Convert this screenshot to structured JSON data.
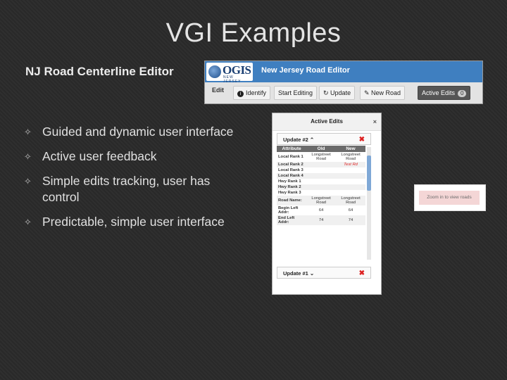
{
  "slide": {
    "title": "VGI Examples",
    "subtitle": "NJ Road Centerline Editor",
    "bullets": [
      "Guided and dynamic user interface",
      "Active user feedback",
      "Simple edits tracking, user has control",
      "Predictable, simple user interface"
    ]
  },
  "editor": {
    "logo_text": "OGIS",
    "logo_sub": "NEW JERSEY",
    "app_title": "New Jersey Road Editor",
    "toolbar": {
      "edit_label": "Edit",
      "identify_label": "Identify",
      "start_label": "Start Editing",
      "update_label": "Update",
      "new_road_label": "New Road",
      "active_label": "Active Edits",
      "active_count": "0"
    }
  },
  "panel": {
    "title": "Active Edits",
    "close": "×",
    "update2": "Update #2 ⌃",
    "update1": "Update #1 ⌄",
    "headers": [
      "Attribute",
      "Old",
      "New"
    ],
    "rows": [
      {
        "attr": "Local Rank 1",
        "old": "Longstreet Road",
        "new": "Longstreet Road"
      },
      {
        "attr": "Local Rank 2",
        "old": "",
        "new": "Test Rd"
      },
      {
        "attr": "Local Rank 3",
        "old": "",
        "new": ""
      },
      {
        "attr": "Local Rank 4",
        "old": "",
        "new": ""
      },
      {
        "attr": "Hwy Rank 1",
        "old": "",
        "new": ""
      },
      {
        "attr": "Hwy Rank 2",
        "old": "",
        "new": ""
      },
      {
        "attr": "Hwy Rank 3",
        "old": "",
        "new": ""
      },
      {
        "attr": "Road Name:",
        "old": "Longstreet Road",
        "new": "Longstreet Road"
      },
      {
        "attr": "Begin Left Addr:",
        "old": "64",
        "new": "64"
      },
      {
        "attr": "End Left Addr:",
        "old": "74",
        "new": "74"
      }
    ]
  },
  "zoom_hint": "Zoom in to view roads",
  "colors": {
    "header_blue": "#3f7fc0",
    "delete_red": "#dd2222"
  }
}
